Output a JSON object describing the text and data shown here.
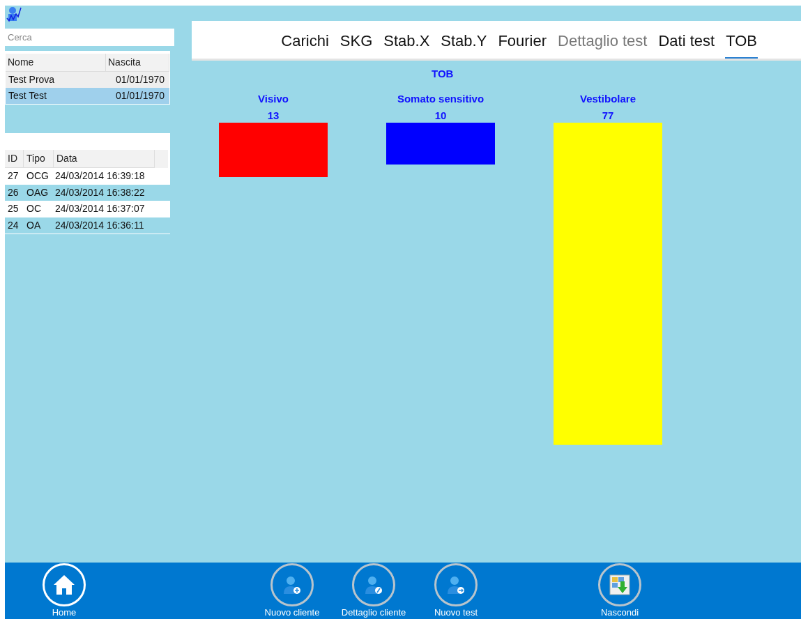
{
  "search": {
    "placeholder": "Cerca"
  },
  "clients": {
    "columns": [
      "Nome",
      "Nascita"
    ],
    "rows": [
      {
        "cells": [
          "Test Prova",
          "01/01/1970"
        ],
        "selected": false
      },
      {
        "cells": [
          "Test Test",
          "01/01/1970"
        ],
        "selected": true
      }
    ]
  },
  "tests": {
    "columns": [
      "ID",
      "Tipo",
      "Data"
    ],
    "rows": [
      {
        "cells": [
          "27",
          "OCG",
          "24/03/2014 16:39:18"
        ]
      },
      {
        "cells": [
          "26",
          "OAG",
          "24/03/2014 16:38:22"
        ]
      },
      {
        "cells": [
          "25",
          "OC",
          "24/03/2014 16:37:07"
        ]
      },
      {
        "cells": [
          "24",
          "OA",
          "24/03/2014 16:36:11"
        ]
      }
    ]
  },
  "tabs": [
    {
      "label": "Carichi",
      "selected": false,
      "disabled": false
    },
    {
      "label": "SKG",
      "selected": false,
      "disabled": false
    },
    {
      "label": "Stab.X",
      "selected": false,
      "disabled": false
    },
    {
      "label": "Stab.Y",
      "selected": false,
      "disabled": false
    },
    {
      "label": "Fourier",
      "selected": false,
      "disabled": false
    },
    {
      "label": "Dettaglio test",
      "selected": false,
      "disabled": true
    },
    {
      "label": "Dati test",
      "selected": false,
      "disabled": false
    },
    {
      "label": "TOB",
      "selected": true,
      "disabled": false
    }
  ],
  "tob": {
    "title": "TOB",
    "items": [
      {
        "label": "Visivo",
        "value": "13",
        "color": "#ff0000"
      },
      {
        "label": "Somato sensitivo",
        "value": "10",
        "color": "#0000ff"
      },
      {
        "label": "Vestibolare",
        "value": "77",
        "color": "#ffff00"
      }
    ]
  },
  "footer": [
    {
      "label": "Home",
      "kind": "home"
    },
    {
      "label": "Nuovo cliente",
      "kind": "add"
    },
    {
      "label": "Dettaglio cliente",
      "kind": "edit"
    },
    {
      "label": "Nuovo test",
      "kind": "next"
    },
    {
      "label": "Nascondi",
      "kind": "hide"
    }
  ]
}
